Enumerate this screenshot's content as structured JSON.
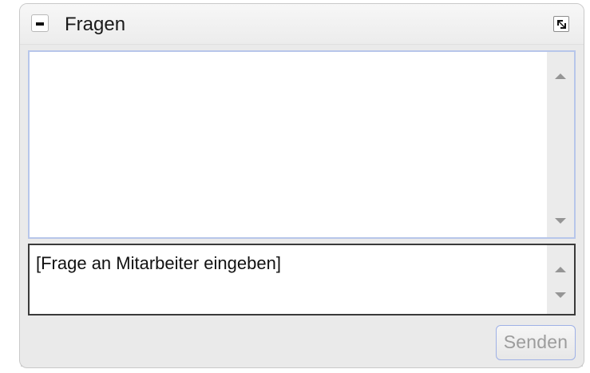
{
  "panel": {
    "title": "Fragen"
  },
  "question_input": {
    "placeholder_text": "[Frage an Mitarbeiter eingeben]"
  },
  "buttons": {
    "send_label": "Senden"
  },
  "icons": {
    "collapse": "minus-icon",
    "expand": "expand-icon",
    "scroll_up": "chevron-up-icon",
    "scroll_down": "chevron-down-icon"
  },
  "colors": {
    "panel_background": "#eaeaea",
    "focus_border": "#b7c6ea",
    "send_border": "#9fb1e6",
    "disabled_text": "#9c9c9c"
  }
}
